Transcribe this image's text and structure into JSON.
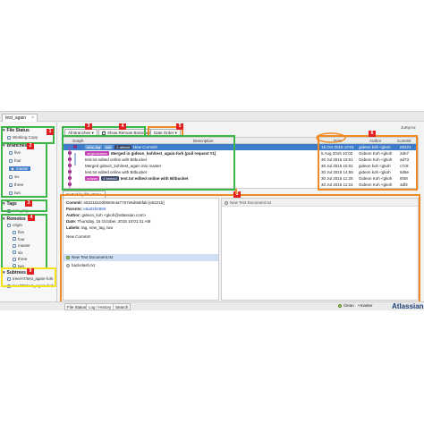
{
  "window": {
    "tab_label": "test_again",
    "tab_close": "×",
    "jump_label": "Jump to:"
  },
  "sidebar": {
    "file_status": {
      "title": "File Status",
      "items": [
        "Working Copy"
      ]
    },
    "branches": {
      "title": "Branches",
      "items": [
        "five",
        "four",
        "master",
        "six",
        "three",
        "two"
      ],
      "selected": "master"
    },
    "tags": {
      "title": "Tags",
      "items": [
        "new_tag"
      ]
    },
    "remotes": {
      "title": "Remotes",
      "origin": "origin",
      "items": [
        "five",
        "four",
        "master",
        "six",
        "three",
        "two"
      ]
    },
    "subtrees": {
      "title": "Subtrees",
      "items": [
        "tree/AT/test_again-fork",
        "tree/BB/test_again-fork"
      ]
    }
  },
  "toolbar": {
    "branch_filter": "All Branches",
    "show_remote": "Show Remote Branches",
    "order": "Date Order"
  },
  "grid": {
    "headers": {
      "graph": "Graph",
      "description": "Description",
      "date": "Date",
      "author": "Author",
      "commit": "Commit"
    },
    "rows": [
      {
        "tags": [
          {
            "t": "new_tag",
            "c": "#6a9fd8"
          },
          {
            "t": "two",
            "c": "#6a9fd8"
          },
          {
            "t": "1 ahead",
            "c": "#3b4a6a"
          }
        ],
        "desc": "New Commit!",
        "date": "15 Oct 2015 10:01",
        "author": "gideon koh <gkoh",
        "commit": "e5221",
        "selected": true
      },
      {
        "tags": [
          {
            "t": "origin/master",
            "c": "#c43eb3"
          }
        ],
        "desc": "Merged in gideon_koh/test_again-fork (pull request #1)",
        "date": "5 Aug 2015 10:02",
        "author": "Gideon Koh <gkoh",
        "commit": "2de7",
        "selected": false
      },
      {
        "tags": [],
        "desc": "test.txt edited online with Bitbucket",
        "date": "30 Jul 2015 15:01",
        "author": "Gideon Koh <gkoh",
        "commit": "ad73",
        "selected": false
      },
      {
        "tags": [],
        "desc": "Merged gideon_koh/test_again into master",
        "date": "30 Jul 2015 15:01",
        "author": "gideon koh <gkoh",
        "commit": "c7c9",
        "selected": false
      },
      {
        "tags": [],
        "desc": "test.txt edited online with Bitbucket",
        "date": "30 Jul 2015 14:55",
        "author": "gideon koh <gkoh",
        "commit": "6d9e",
        "selected": false
      },
      {
        "tags": [
          {
            "t": "master",
            "c": "#c43eb3"
          },
          {
            "t": "4 behind",
            "c": "#3b4a6a"
          }
        ],
        "desc": "test.txt edited online with Bitbucket",
        "date": "30 Jul 2015 11:25",
        "author": "Gideon Koh <gkoh",
        "commit": "8f48",
        "selected": false
      },
      {
        "tags": [],
        "desc": "",
        "date": "30 Jul 2015 11:24",
        "author": "Gideon Koh <gkoh",
        "commit": "3df2",
        "selected": false
      }
    ]
  },
  "sorted_by": "Sorted by file status",
  "details": {
    "commit_label": "Commit:",
    "commit_value": "e5221610d0593e4a7757e6d9abfab [e5221b]",
    "parents_label": "Parents:",
    "parents_value": "e5a02b0860",
    "author_label": "Author:",
    "author_value": "gideon_koh <gkoh@atlassian.com>",
    "date_label": "Date:",
    "date_value": "Thursday, 15 October, 2015 10:01:41 AM",
    "labels_label": "Labels:",
    "labels_value": "tag, new_tag, two",
    "message": "New Commit!",
    "files": [
      "New Text Document.txt",
      "backslash.txt"
    ]
  },
  "diff": {
    "header": "New Text Document.txt"
  },
  "status": {
    "tabs": [
      "File Status",
      "Log / History",
      "Search"
    ],
    "clean": "Clean",
    "branch": "master",
    "brand": "Atlassian"
  },
  "badges": [
    "1",
    "2",
    "3",
    "4",
    "5",
    "6",
    "7",
    "8",
    "9"
  ],
  "colors": {
    "green": "#3cb54a",
    "orange": "#f08a24",
    "yellow": "#f4e21b",
    "badge": "#e02020",
    "selection": "#3d7cc9"
  }
}
